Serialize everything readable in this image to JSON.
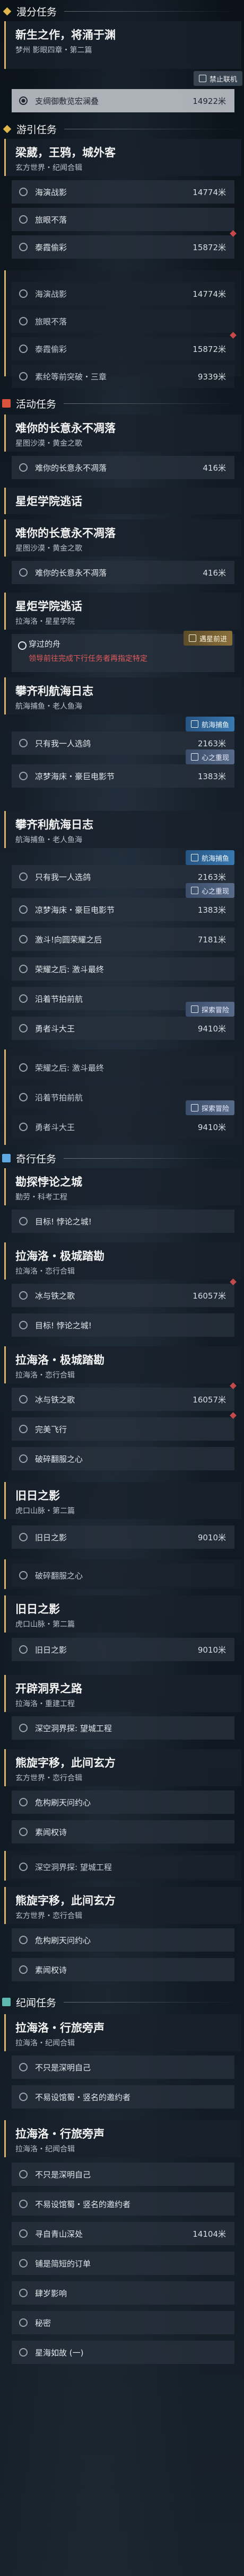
{
  "sections": {
    "world": "漫分任务",
    "lead": "游引任务",
    "activity": "活动任务",
    "daily": "奇行任务",
    "events": "纪闻任务"
  },
  "quest1": {
    "title": "新生之作，将涌于渊",
    "sub": "梦州 影眼四章・第二篇",
    "join": "禁止联机",
    "row1": "支绸御敷览宏澜叠",
    "row1_dist": "14922米"
  },
  "quest2": {
    "title": "梁葳，王鸦，城外客",
    "sub": "玄方世界・纪闻合辑",
    "rows": [
      "海演战影",
      "旅眼不落",
      "泰霞偷彩"
    ],
    "dists": [
      "14774米",
      "",
      "15872米"
    ]
  },
  "quest2b": {
    "rows": [
      "海演战影",
      "旅眼不落",
      "泰霞偷彩",
      "素纶等前突破・三章"
    ],
    "dists": [
      "14774米",
      "",
      "15872米",
      "9339米"
    ]
  },
  "quest3": {
    "title": "难你的长意永不凋落",
    "sub": "星图沙漠・黄金之歌",
    "row1": "难你的长意永不凋落",
    "row1_dist": "416米"
  },
  "quest4": {
    "title": "星炬学院逃话",
    "sub": ""
  },
  "quest5": {
    "title": "难你的长意永不凋落",
    "sub": "星图沙漠・黄金之歌",
    "row1": "难你的长意永不凋落",
    "row1_dist": "416米"
  },
  "quest6": {
    "title": "星炬学院逃话",
    "sub": "拉海洛・星星学院",
    "hint_label": "穿过的舟",
    "hint_red": "领导前往完成下行任务者再指定特定",
    "guide": "遇星前进"
  },
  "quest7": {
    "title": "攀齐利航海日志",
    "sub": "航海捕鱼・老人鱼海",
    "rows": [
      "只有我一人选鸽",
      "凉梦海床・豪巨电影节"
    ],
    "dists": [
      "2163米",
      "1383米"
    ],
    "nav": "航海捕鱼",
    "coop": "心之重现"
  },
  "quest8": {
    "title": "攀齐利航海日志",
    "sub": "航海捕鱼・老人鱼海",
    "rows": [
      "只有我一人选鸽",
      "凉梦海床・豪巨电影节",
      "激斗!向圆荣耀之后",
      "荣耀之后: 激斗最终",
      "沿着节拍前航",
      "勇者斗大王"
    ],
    "dists": [
      "2163米",
      "1383米",
      "7181米",
      "",
      "",
      "9410米"
    ],
    "nav": "航海捕鱼",
    "coop": "心之重现",
    "adv": "探索冒险"
  },
  "quest8b": {
    "rows": [
      "荣耀之后: 激斗最终",
      "沿着节拍前航",
      "勇者斗大王"
    ],
    "dists": [
      "",
      "",
      "9410米"
    ],
    "adv": "探索冒险"
  },
  "quest9": {
    "title": "勘探悖论之城",
    "sub": "勤劳・科考工程",
    "row1": "目标! 悖论之城!"
  },
  "quest10": {
    "title": "拉海洛・极城踏勘",
    "sub": "拉海洛・恋行合辑",
    "rows": [
      "冰与铁之歌",
      "目标! 悖论之城!"
    ],
    "dists": [
      "16057米",
      ""
    ]
  },
  "quest11": {
    "title": "拉海洛・极城踏勘",
    "sub": "拉海洛・恋行合辑",
    "rows": [
      "冰与铁之歌",
      "完美飞行",
      "破碎翻服之心"
    ],
    "dists": [
      "16057米",
      "",
      ""
    ]
  },
  "quest12": {
    "title": "旧日之影",
    "sub": "虎口山脉・第二篇",
    "row1": "旧日之影",
    "row1_dist": "9010米"
  },
  "quest12b": {
    "row1": "破碎翻服之心"
  },
  "quest13": {
    "title": "旧日之影",
    "sub": "虎口山脉・第二篇",
    "row1": "旧日之影",
    "row1_dist": "9010米"
  },
  "quest14": {
    "title": "开辟洞界之路",
    "sub": "拉海洛・重建工程",
    "row1": "深空洞界探: 望城工程"
  },
  "quest15": {
    "title": "熊旋字移，此间玄方",
    "sub": "玄方世界・恋行合辑",
    "row1": "危构刷天问约心",
    "row2": "素闻权诗"
  },
  "quest15b": {
    "row1": "深空洞界探: 望城工程"
  },
  "quest16": {
    "title": "熊旋字移，此间玄方",
    "sub": "玄方世界・恋行合辑",
    "rows": [
      "危构刷天问约心",
      "素闻权诗"
    ]
  },
  "quest17": {
    "title": "拉海洛・行旅旁声",
    "sub": "拉海洛・纪闻合辑",
    "rows": [
      "不只是深明自己",
      "不易设馆蜀・竖名的邀约者"
    ]
  },
  "quest18": {
    "title": "拉海洛・行旅旁声",
    "sub": "拉海洛・纪闻合辑",
    "rows": [
      "不只是深明自己",
      "不易设馆蜀・竖名的邀约者",
      "寻自青山深处",
      "铺是简短的订单",
      "肆岁影响",
      "秘密",
      "星海如故 (一)"
    ],
    "dists": [
      "",
      "",
      "14104米",
      "",
      "",
      "",
      ""
    ]
  }
}
